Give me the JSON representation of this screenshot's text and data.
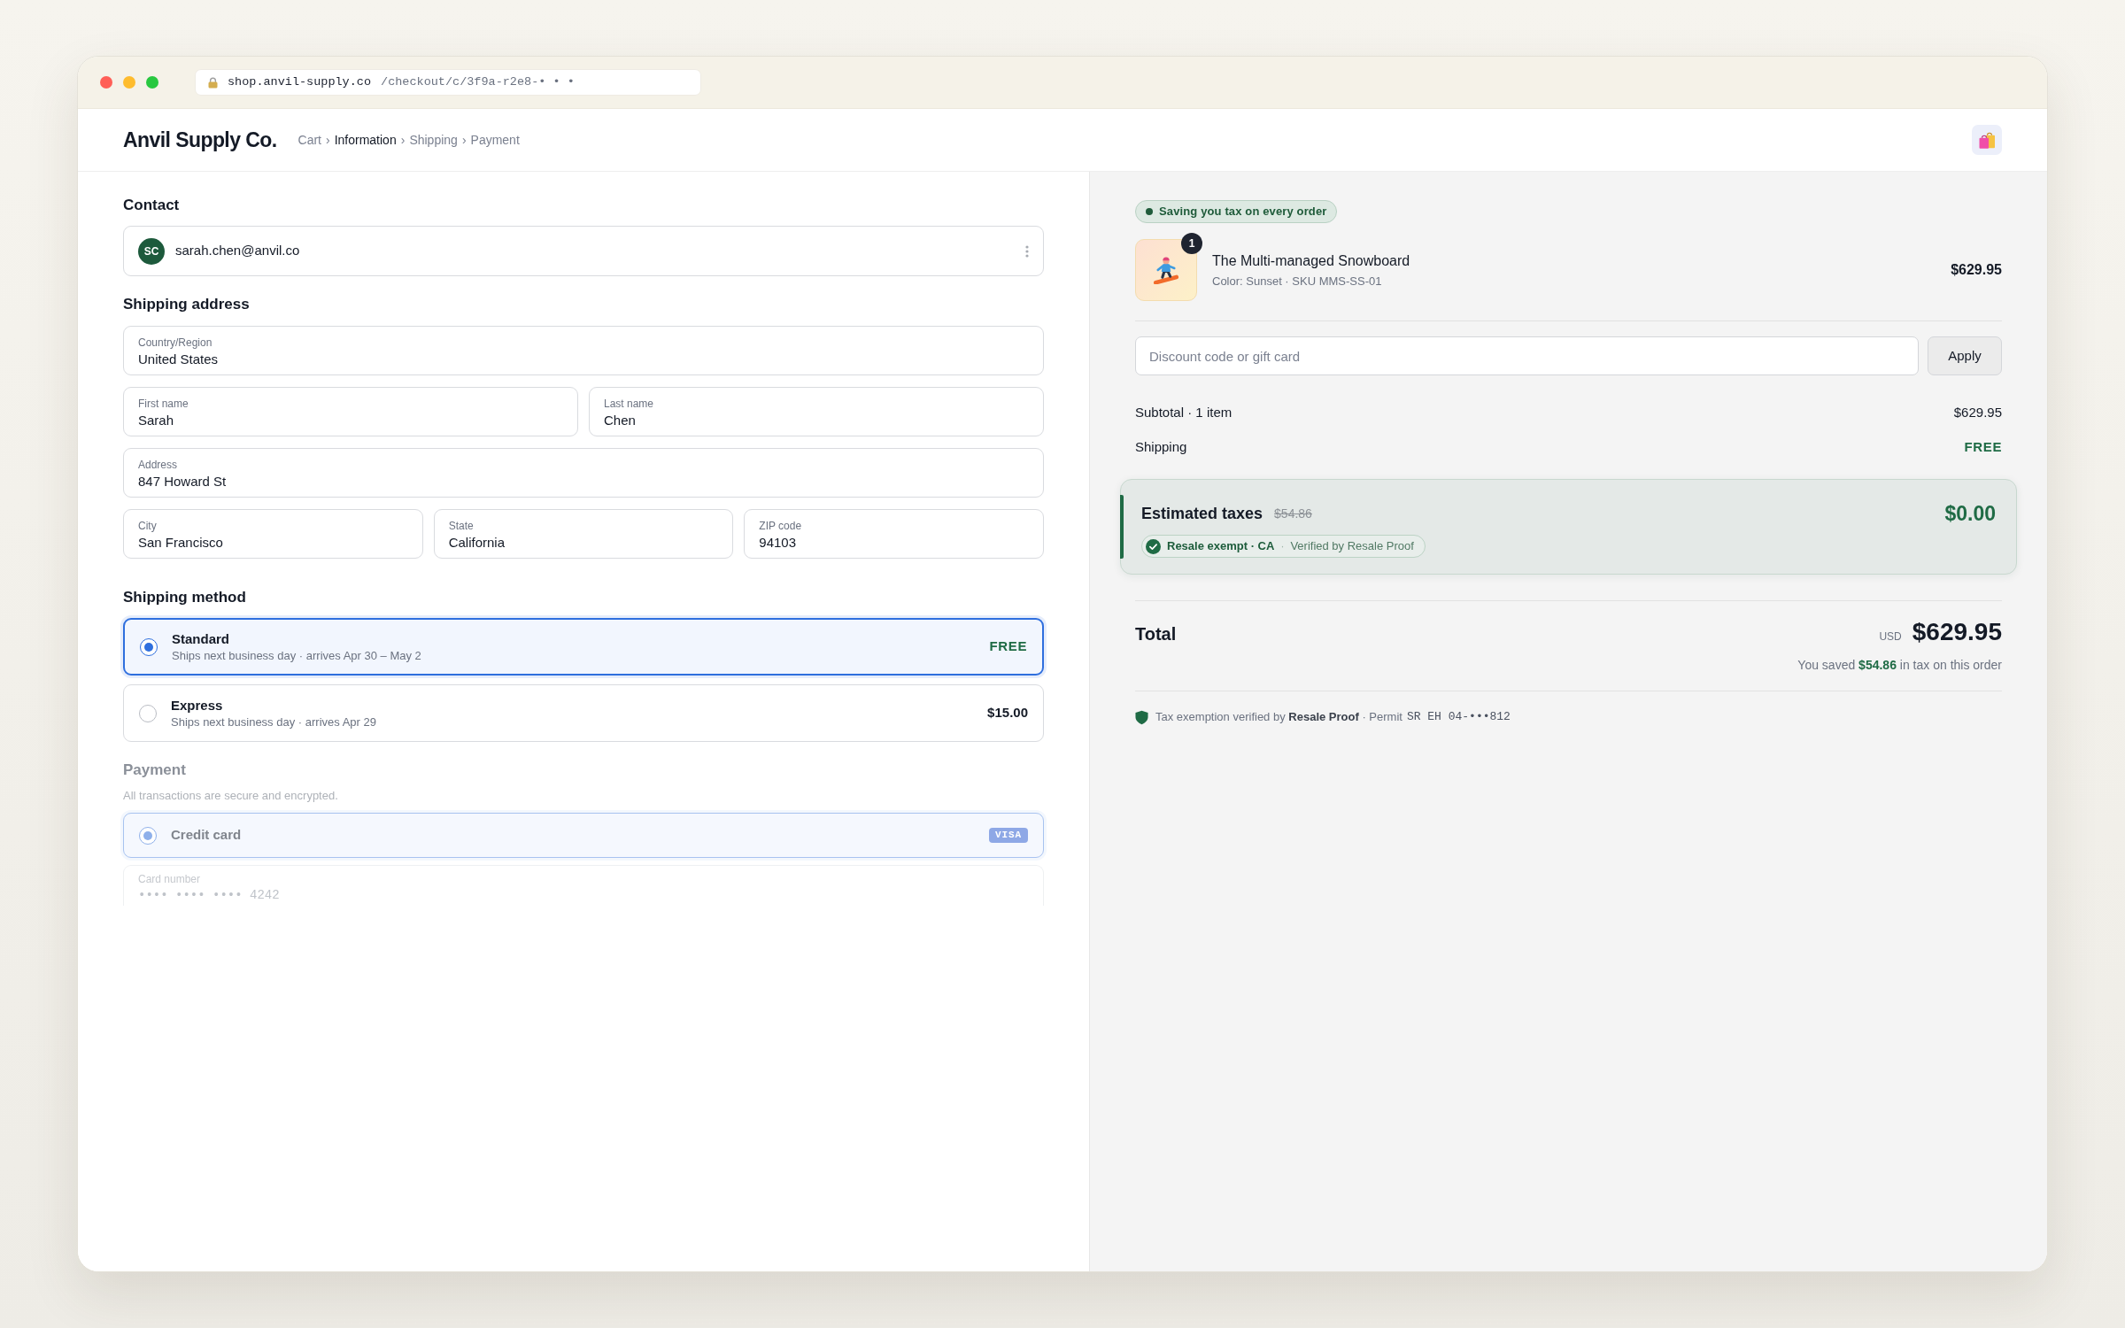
{
  "window": {
    "url_host": "shop.anvil-supply.co",
    "url_path": "/checkout/c/3f9a-r2e8-• • •"
  },
  "header": {
    "brand": "Anvil Supply Co.",
    "breadcrumbs": [
      {
        "label": "Cart",
        "selected": false
      },
      {
        "label": "Information",
        "selected": true,
        "separator": "›"
      },
      {
        "label": "Shipping",
        "selected": false,
        "separator": "›"
      },
      {
        "label": "Payment",
        "selected": false,
        "separator": "›"
      }
    ]
  },
  "contact": {
    "heading": "Contact",
    "initials": "SC",
    "email": "sarah.chen@anvil.co"
  },
  "shipping_address": {
    "heading": "Shipping address",
    "rows": [
      {
        "fields": [
          {
            "label": "Country/Region",
            "value": "United States"
          }
        ]
      },
      {
        "fields": [
          {
            "label": "First name",
            "value": "Sarah"
          },
          {
            "label": "Last name",
            "value": "Chen"
          }
        ]
      },
      {
        "fields": [
          {
            "label": "Address",
            "value": "847 Howard St"
          }
        ]
      },
      {
        "fields": [
          {
            "label": "City",
            "value": "San Francisco"
          },
          {
            "label": "State",
            "value": "California"
          },
          {
            "label": "ZIP code",
            "value": "94103"
          }
        ]
      }
    ]
  },
  "shipping_method": {
    "heading": "Shipping method",
    "options": [
      {
        "name": "Standard",
        "detail": "Ships next business day · arrives Apr 30 – May 2",
        "price": "FREE",
        "kind": "free",
        "selected": true
      },
      {
        "name": "Express",
        "detail": "Ships next business day · arrives Apr 29",
        "price": "$15.00",
        "kind": "paid",
        "selected": false
      }
    ]
  },
  "payment": {
    "heading": "Payment",
    "disabled": true,
    "note": "All transactions are secure and encrypted.",
    "methods": [
      {
        "name": "Credit card",
        "badge": "VISA",
        "selected": true
      }
    ],
    "card_number": {
      "label": "Card number",
      "value": "•••• •••• •••• 4242"
    }
  },
  "summary": {
    "badge": "Saving you tax on every order",
    "items": [
      {
        "name": "The Multi-managed Snowboard",
        "variant": "Color: Sunset · SKU MMS-SS-01",
        "price": "$629.95",
        "quantity": "1"
      }
    ],
    "discount": {
      "placeholder": "Discount code or gift card",
      "button": "Apply"
    },
    "lines": [
      {
        "label": "Subtotal · 1 item",
        "value": "$629.95",
        "kind": "plain"
      },
      {
        "label": "Shipping",
        "value": "FREE",
        "kind": "free"
      }
    ],
    "taxes": {
      "label": "Estimated taxes",
      "original": "$54.86",
      "amount": "$0.00",
      "exemption": "Resale exempt · CA",
      "separator": "·",
      "verifier": "Verified by Resale Proof"
    },
    "total": {
      "label": "Total",
      "currency": "USD",
      "amount": "$629.95",
      "savings_note": "You saved **$54.86** in tax on this order"
    },
    "footer": {
      "note": "Tax exemption verified by **Resale Proof** · Permit",
      "permit": "SR EH 04-•••812"
    }
  }
}
